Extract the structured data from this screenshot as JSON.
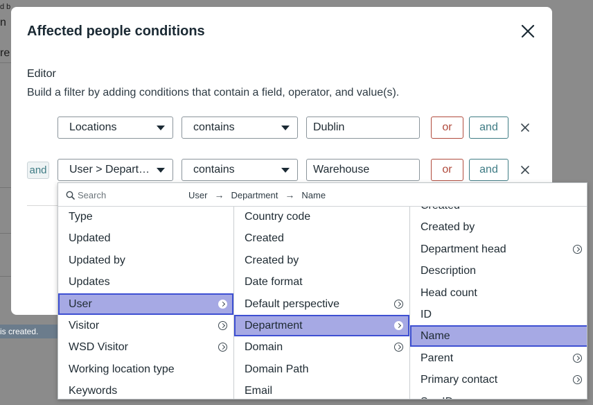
{
  "background": {
    "top_left_text_1": "d b",
    "top_left_text_2": "n",
    "side_text": "re",
    "status_banner": "is created."
  },
  "modal": {
    "title": "Affected people conditions",
    "editor_label": "Editor",
    "editor_help": "Build a filter by adding conditions that contain a field, operator, and value(s).",
    "conditions": [
      {
        "field": "Locations",
        "operator": "contains",
        "value": "Dublin",
        "or_label": "or",
        "and_label": "and"
      },
      {
        "prefix": "and",
        "field": "User > Depart…",
        "operator": "contains",
        "value": "Warehouse",
        "or_label": "or",
        "and_label": "and"
      }
    ]
  },
  "picker": {
    "search_placeholder": "Search",
    "breadcrumb": [
      "User",
      "Department",
      "Name"
    ],
    "breadcrumb_separator": "→",
    "columns": [
      {
        "items": [
          {
            "label": "Type",
            "has_children": false,
            "selected": false
          },
          {
            "label": "Updated",
            "has_children": false,
            "selected": false
          },
          {
            "label": "Updated by",
            "has_children": false,
            "selected": false
          },
          {
            "label": "Updates",
            "has_children": false,
            "selected": false
          },
          {
            "label": "User",
            "has_children": true,
            "selected": true
          },
          {
            "label": "Visitor",
            "has_children": true,
            "selected": false
          },
          {
            "label": "WSD Visitor",
            "has_children": true,
            "selected": false
          },
          {
            "label": "Working location type",
            "has_children": false,
            "selected": false
          },
          {
            "label": "Keywords",
            "has_children": false,
            "selected": false
          }
        ]
      },
      {
        "items": [
          {
            "label": "Country code",
            "has_children": false,
            "selected": false
          },
          {
            "label": "Created",
            "has_children": false,
            "selected": false
          },
          {
            "label": "Created by",
            "has_children": false,
            "selected": false
          },
          {
            "label": "Date format",
            "has_children": false,
            "selected": false
          },
          {
            "label": "Default perspective",
            "has_children": true,
            "selected": false
          },
          {
            "label": "Department",
            "has_children": true,
            "selected": true
          },
          {
            "label": "Domain",
            "has_children": true,
            "selected": false
          },
          {
            "label": "Domain Path",
            "has_children": false,
            "selected": false
          },
          {
            "label": "Email",
            "has_children": false,
            "selected": false
          }
        ]
      },
      {
        "items": [
          {
            "label": "Created",
            "has_children": false,
            "selected": false
          },
          {
            "label": "Created by",
            "has_children": false,
            "selected": false
          },
          {
            "label": "Department head",
            "has_children": true,
            "selected": false
          },
          {
            "label": "Description",
            "has_children": false,
            "selected": false
          },
          {
            "label": "Head count",
            "has_children": false,
            "selected": false
          },
          {
            "label": "ID",
            "has_children": false,
            "selected": false
          },
          {
            "label": "Name",
            "has_children": false,
            "selected": true
          },
          {
            "label": "Parent",
            "has_children": true,
            "selected": false
          },
          {
            "label": "Primary contact",
            "has_children": true,
            "selected": false
          },
          {
            "label": "Sys ID",
            "has_children": false,
            "selected": false
          }
        ]
      }
    ]
  }
}
